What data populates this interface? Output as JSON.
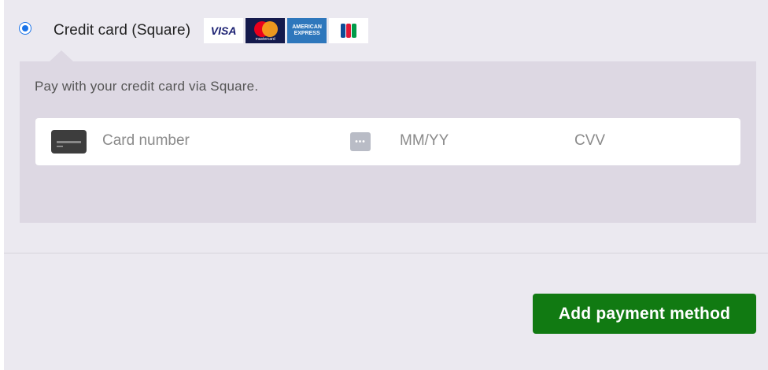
{
  "payment_method": {
    "label": "Credit card (Square)",
    "selected": true,
    "accent_color": "#1a73e8",
    "card_brands": [
      {
        "name": "visa",
        "text": "VISA"
      },
      {
        "name": "mastercard",
        "text": "mastercard"
      },
      {
        "name": "amex",
        "text_line1": "AMERICAN",
        "text_line2": "EXPRESS"
      },
      {
        "name": "jcb",
        "text": ""
      }
    ]
  },
  "panel": {
    "description": "Pay with your credit card via Square.",
    "background_color": "#ddd8e3"
  },
  "card_form": {
    "card_number_placeholder": "Card number",
    "expiry_placeholder": "MM/YY",
    "cvv_placeholder": "CVV",
    "cvv_icon_glyph": "•••",
    "card_icon": "credit-card-icon"
  },
  "actions": {
    "add_payment_label": "Add payment method",
    "button_color": "#117a12"
  }
}
